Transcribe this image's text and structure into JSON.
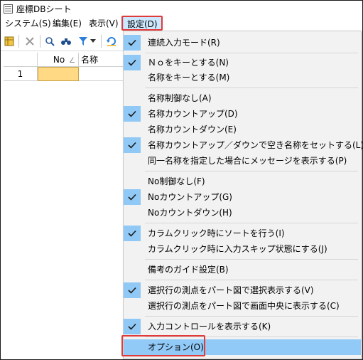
{
  "window": {
    "title": "座標DBシート"
  },
  "menubar": {
    "items": [
      {
        "label": "システム(S)"
      },
      {
        "label": "編集(E)"
      },
      {
        "label": "表示(V)"
      },
      {
        "label": "設定(D)"
      }
    ],
    "active_index": 3
  },
  "toolbar": {
    "icons": [
      "table-icon",
      "delete-icon",
      "search-icon",
      "find-icon",
      "filter-icon",
      "dropdown-arrow-icon",
      "refresh-icon"
    ]
  },
  "grid": {
    "columns": [
      {
        "label": "No",
        "sort_indicator": "∠"
      },
      {
        "label": "名称"
      }
    ],
    "rows": [
      {
        "row_number": "1",
        "no": "",
        "name": ""
      }
    ]
  },
  "settings_menu": {
    "items": [
      {
        "label": "連続入力モード(R)",
        "checked": true
      },
      {
        "label": "Ｎｏをキーとする(N)",
        "checked": true
      },
      {
        "label": "名称をキーとする(M)",
        "checked": false
      },
      {
        "label": "名称制御なし(A)",
        "checked": false
      },
      {
        "label": "名称カウントアップ(D)",
        "checked": true
      },
      {
        "label": "名称カウントダウン(E)",
        "checked": false
      },
      {
        "label": "名称カウントアップ／ダウンで空き名称をセットする(L)",
        "checked": true
      },
      {
        "label": "同一名称を指定した場合にメッセージを表示する(P)",
        "checked": false
      },
      {
        "label": "No制御なし(F)",
        "checked": false
      },
      {
        "label": "Noカウントアップ(G)",
        "checked": true
      },
      {
        "label": "Noカウントダウン(H)",
        "checked": false
      },
      {
        "label": "カラムクリック時にソートを行う(I)",
        "checked": true
      },
      {
        "label": "カラムクリック時に入力スキップ状態にする(J)",
        "checked": false
      },
      {
        "label": "備考のガイド設定(B)",
        "checked": false
      },
      {
        "label": "選択行の測点をパート図で選択表示する(V)",
        "checked": true
      },
      {
        "label": "選択行の測点をパート図で画面中央に表示する(C)",
        "checked": false
      },
      {
        "label": "入力コントロールを表示する(K)",
        "checked": true
      },
      {
        "label": "オプション(O)",
        "checked": false,
        "selected": true
      }
    ]
  },
  "colors": {
    "highlight_box": "#e03a3a",
    "check_bg": "#90c8f6",
    "selected_bg": "#91c9f7",
    "menu_bg": "#f2f2f2",
    "active_cell": "#ffd983"
  }
}
